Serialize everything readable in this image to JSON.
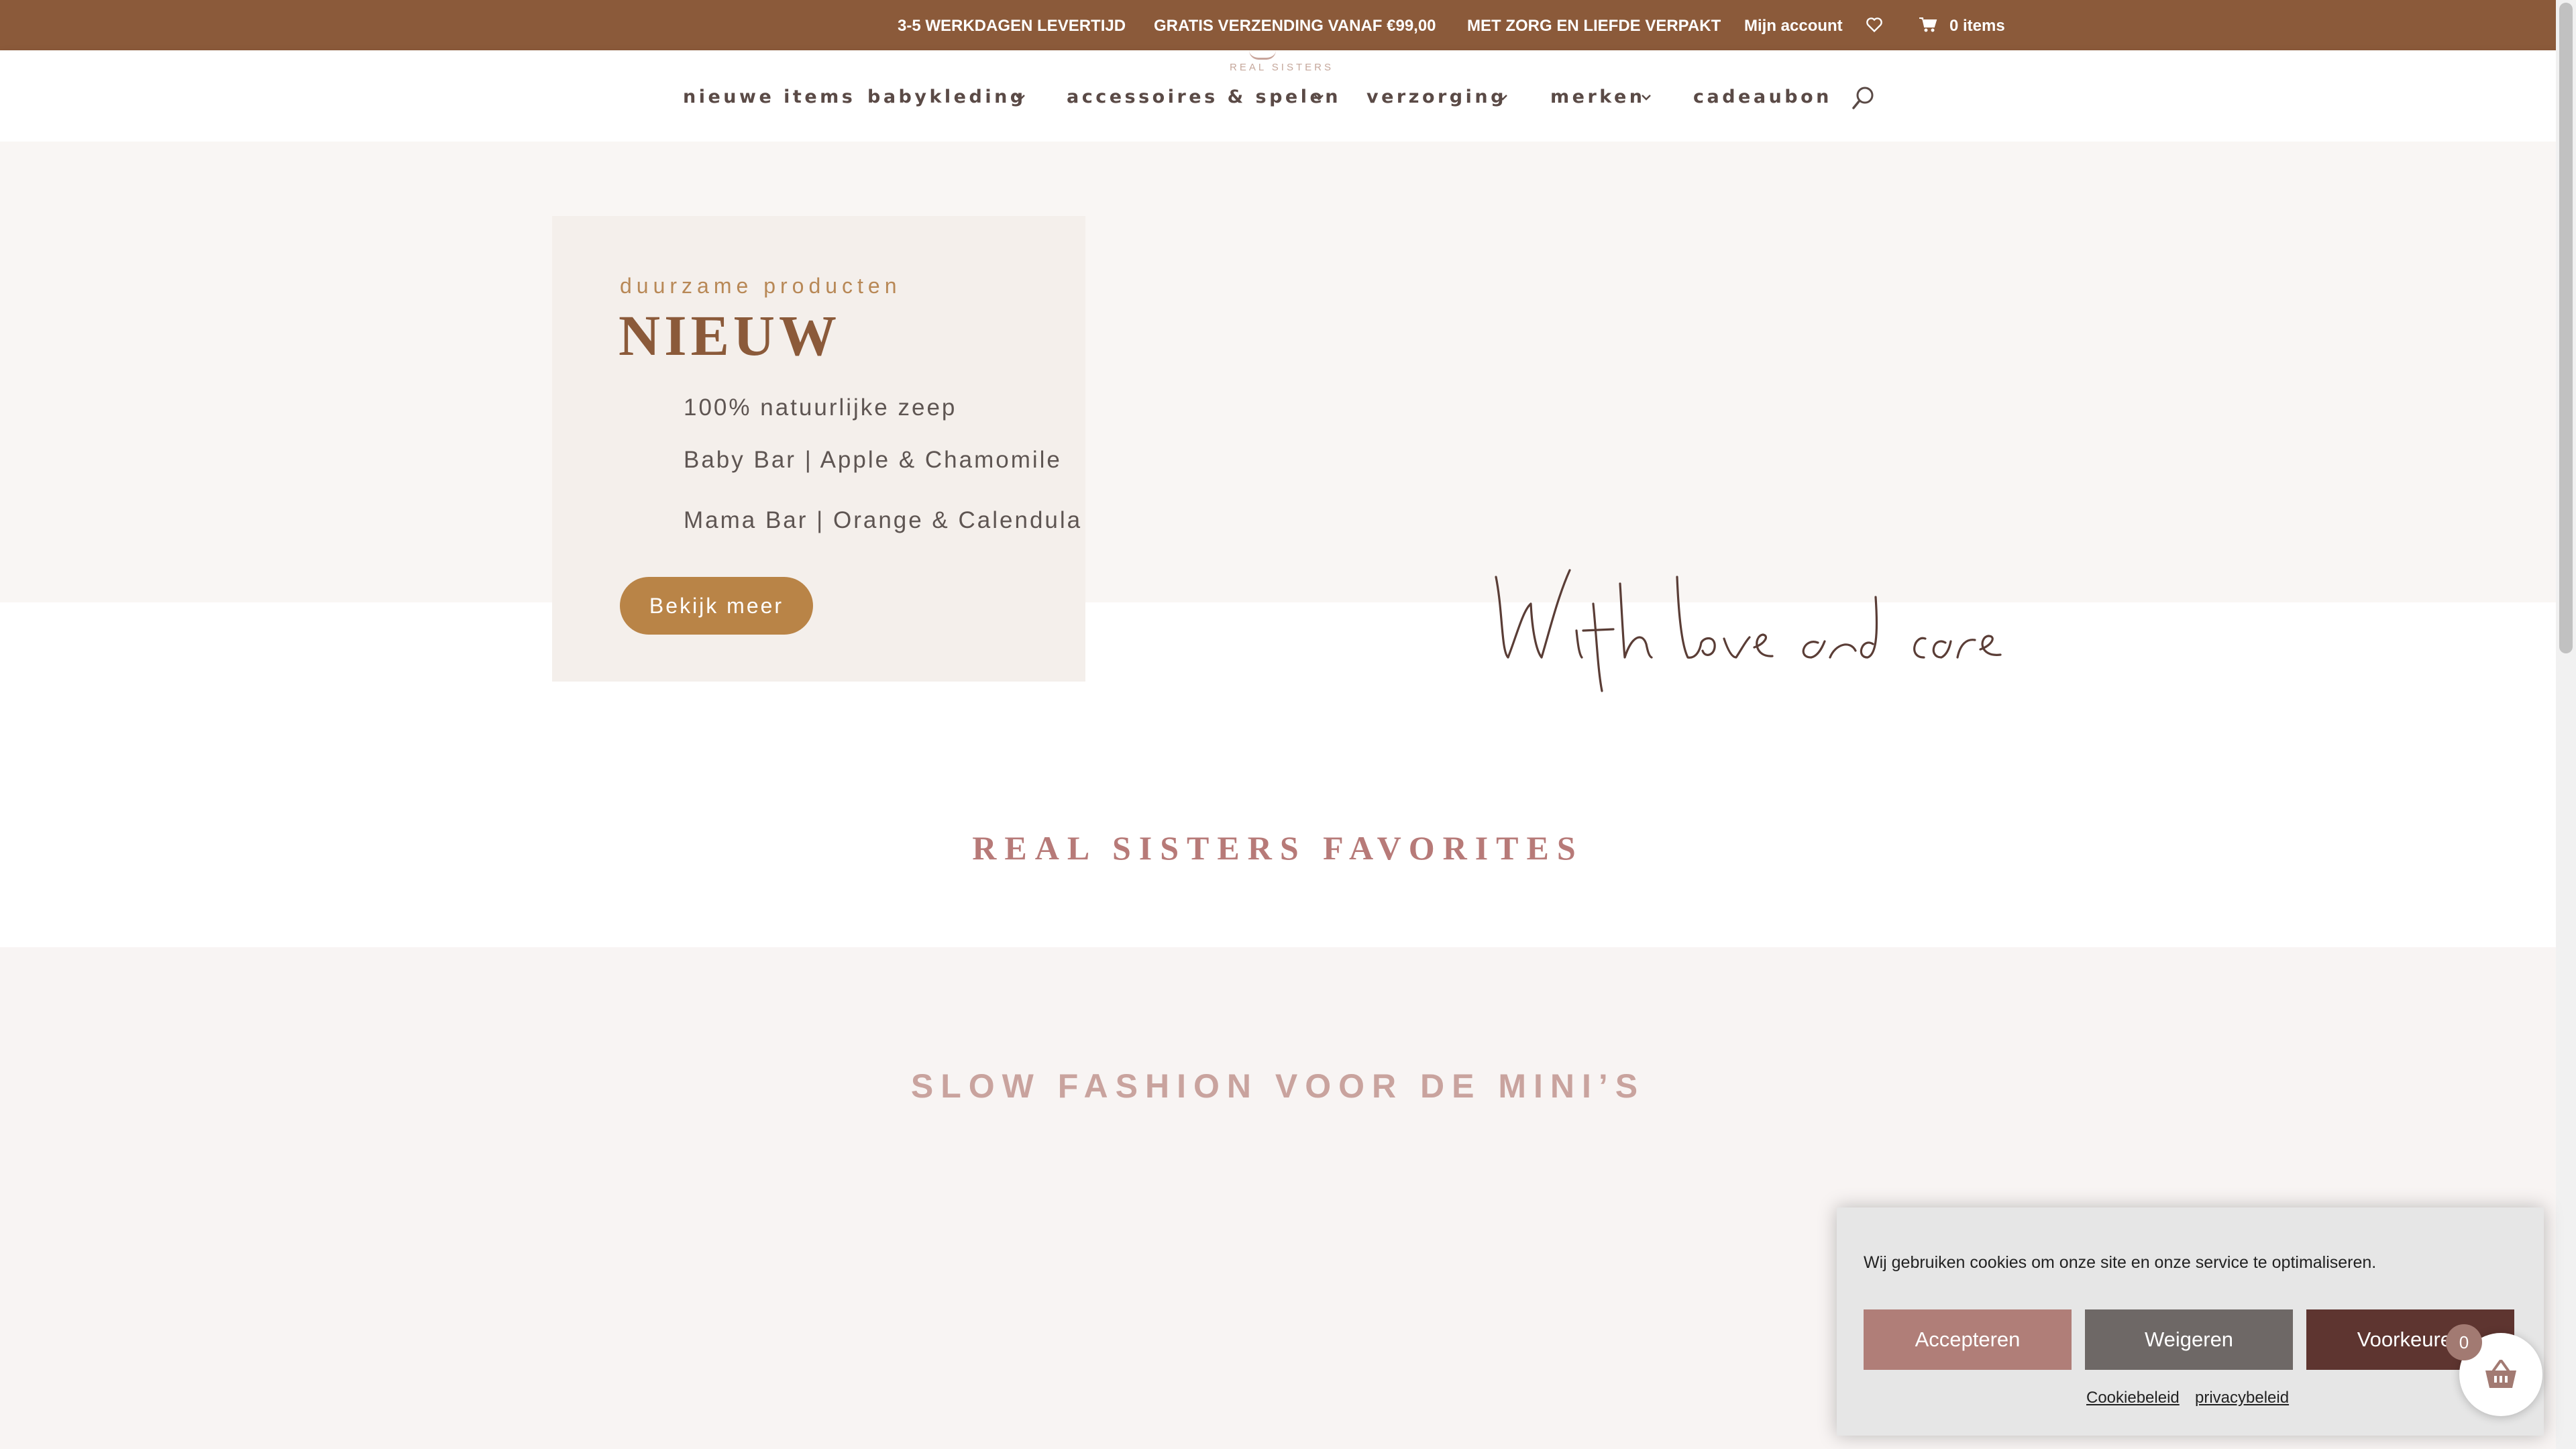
{
  "topbar": {
    "items": [
      "3-5 WERKDAGEN LEVERTIJD",
      "GRATIS VERZENDING VANAF €99,00",
      "MET ZORG EN LIEFDE VERPAKT"
    ],
    "account_label": "Mijn account",
    "cart_label": "0 items"
  },
  "header": {
    "logo_text": "REAL SISTERS",
    "nav": {
      "nieuwe_items": "nieuwe items",
      "babykleding": "babykleding",
      "accessoires": "accessoires & spelen",
      "verzorging": "verzorging",
      "merken": "merken",
      "cadeaubon": "cadeaubon"
    }
  },
  "hero": {
    "kicker": "duurzame producten",
    "title": "NIEUW",
    "lines": [
      "100% natuurlijke zeep",
      "Baby Bar | Apple & Chamomile",
      "Mama Bar | Orange & Calendula"
    ],
    "button_label": "Bekijk meer"
  },
  "sections": {
    "favorites_title": "REAL SISTERS FAVORITES",
    "slow_fashion_title": "SLOW FASHION VOOR DE MINI’S"
  },
  "cookie": {
    "text": "Wij gebruiken cookies om onze site en onze service te optimaliseren.",
    "accept": "Accepteren",
    "deny": "Weigeren",
    "preferences": "Voorkeuren",
    "cookie_policy": "Cookiebeleid",
    "privacy_policy": "privacybeleid"
  },
  "floating_cart": {
    "count": "0"
  },
  "colors": {
    "topbar": "#8b5a3a",
    "accent_gold": "#b98447",
    "accent_rose": "#b07e78",
    "dark_plum": "#5e3530"
  }
}
